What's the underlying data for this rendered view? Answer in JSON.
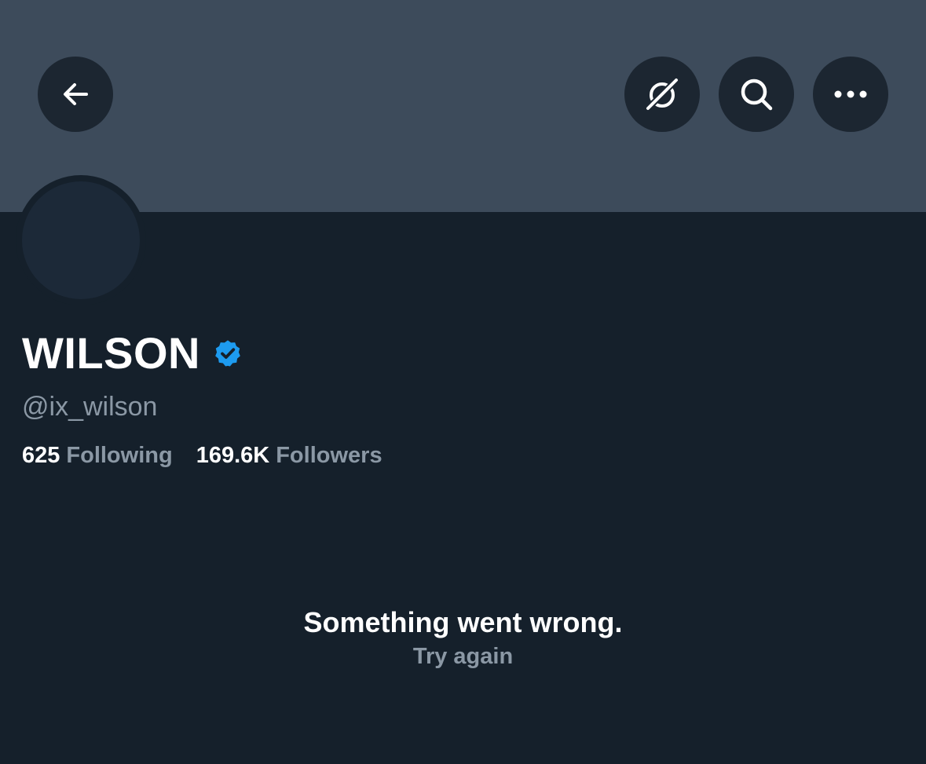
{
  "header": {
    "buttons": [
      {
        "name": "back",
        "icon": "arrow-left-icon"
      },
      {
        "name": "grok",
        "icon": "grok-icon"
      },
      {
        "name": "search",
        "icon": "search-icon"
      },
      {
        "name": "more",
        "icon": "more-horizontal-icon"
      }
    ]
  },
  "profile": {
    "display_name": "WILSON",
    "verified_icon": "verified-badge-icon",
    "handle": "@ix_wilson",
    "following_count": "625",
    "following_label": "Following",
    "followers_count": "169.6K",
    "followers_label": "Followers"
  },
  "error": {
    "message": "Something went wrong.",
    "retry_label": "Try again"
  },
  "colors": {
    "background": "#15202b",
    "banner": "#3d4b5b",
    "button_bg": "#1c2631",
    "secondary_text": "#8b98a5",
    "verified_blue": "#1d9bf0"
  }
}
